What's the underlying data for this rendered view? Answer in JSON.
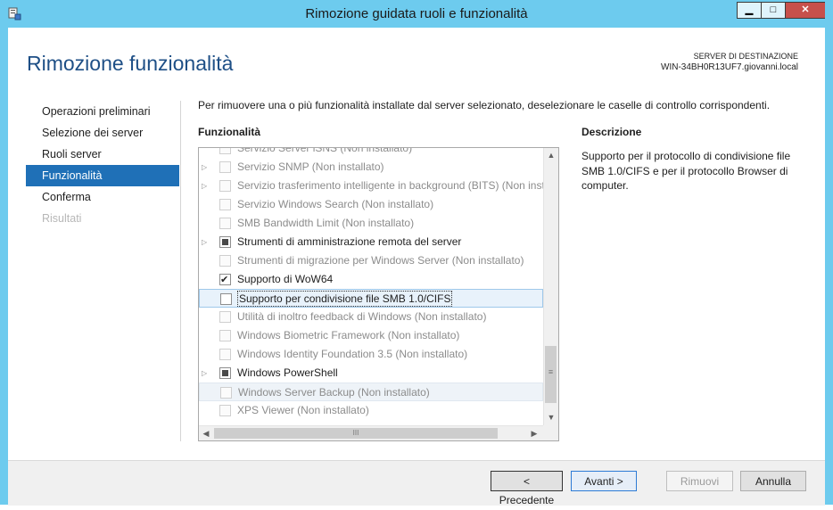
{
  "window": {
    "title": "Rimozione guidata ruoli e funzionalità",
    "controls": [
      "minimize",
      "maximize",
      "close"
    ]
  },
  "header": {
    "page_title": "Rimozione funzionalità",
    "server_label": "SERVER DI DESTINAZIONE",
    "server_name": "WIN-34BH0R13UF7.giovanni.local"
  },
  "nav": {
    "items": [
      {
        "label": "Operazioni preliminari",
        "state": "normal"
      },
      {
        "label": "Selezione dei server",
        "state": "normal"
      },
      {
        "label": "Ruoli server",
        "state": "normal"
      },
      {
        "label": "Funzionalità",
        "state": "active"
      },
      {
        "label": "Conferma",
        "state": "normal"
      },
      {
        "label": "Risultati",
        "state": "disabled"
      }
    ]
  },
  "main": {
    "instructions": "Per rimuovere una o più funzionalità installate dal server selezionato, deselezionare le caselle di controllo corrispondenti.",
    "features_label": "Funzionalità",
    "features": [
      {
        "label": "Servizio Server iSNS (Non installato)",
        "expander": false,
        "check": "none",
        "enabled": false
      },
      {
        "label": "Servizio SNMP (Non installato)",
        "expander": true,
        "check": "none",
        "enabled": false
      },
      {
        "label": "Servizio trasferimento intelligente in background (BITS) (Non inst",
        "expander": true,
        "check": "none",
        "enabled": false
      },
      {
        "label": "Servizio Windows Search (Non installato)",
        "expander": false,
        "check": "none",
        "enabled": false
      },
      {
        "label": "SMB Bandwidth Limit (Non installato)",
        "expander": false,
        "check": "none",
        "enabled": false
      },
      {
        "label": "Strumenti di amministrazione remota del server",
        "expander": true,
        "check": "partial",
        "enabled": true
      },
      {
        "label": "Strumenti di migrazione per Windows Server (Non installato)",
        "expander": false,
        "check": "none",
        "enabled": false
      },
      {
        "label": "Supporto di WoW64",
        "expander": false,
        "check": "checked",
        "enabled": true
      },
      {
        "label": "Supporto per condivisione file SMB 1.0/CIFS",
        "expander": false,
        "check": "none",
        "enabled": true,
        "selected": true
      },
      {
        "label": "Utilità di inoltro feedback di Windows (Non installato)",
        "expander": false,
        "check": "none",
        "enabled": false
      },
      {
        "label": "Windows Biometric Framework (Non installato)",
        "expander": false,
        "check": "none",
        "enabled": false
      },
      {
        "label": "Windows Identity Foundation 3.5 (Non installato)",
        "expander": false,
        "check": "none",
        "enabled": false
      },
      {
        "label": "Windows PowerShell",
        "expander": true,
        "check": "partial",
        "enabled": true
      },
      {
        "label": "Windows Server Backup (Non installato)",
        "expander": false,
        "check": "none",
        "enabled": false,
        "hover": true
      },
      {
        "label": "XPS Viewer (Non installato)",
        "expander": false,
        "check": "none",
        "enabled": false
      }
    ],
    "scrollbar_grip": "≡",
    "hscroll_grip": "III"
  },
  "description": {
    "title": "Descrizione",
    "text": "Supporto per il protocollo di condivisione file SMB 1.0/CIFS e per il protocollo Browser di computer."
  },
  "footer": {
    "prev_label": "< Precedente",
    "next_label": "Avanti >",
    "remove_label": "Rimuovi",
    "cancel_label": "Annulla"
  }
}
